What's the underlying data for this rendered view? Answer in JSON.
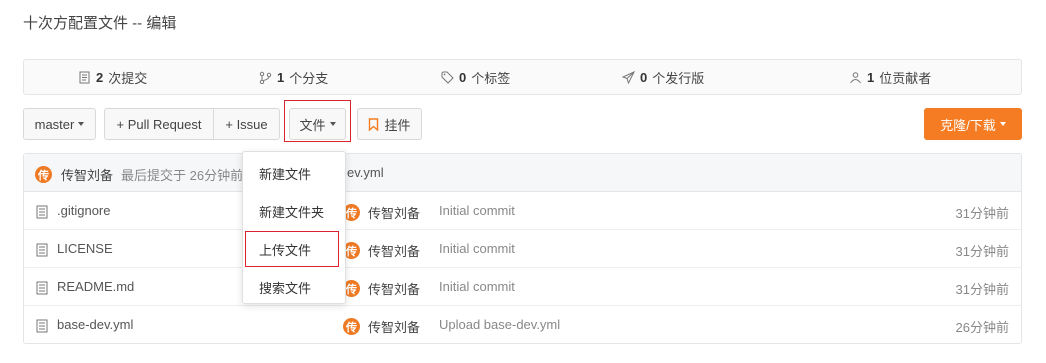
{
  "page": {
    "title": "十次方配置文件 -- 编辑"
  },
  "stats": [
    {
      "icon": "commit-icon",
      "count": "2",
      "label": "次提交"
    },
    {
      "icon": "branch-icon",
      "count": "1",
      "label": "个分支"
    },
    {
      "icon": "tag-icon",
      "count": "0",
      "label": "个标签"
    },
    {
      "icon": "release-icon",
      "count": "0",
      "label": "个发行版"
    },
    {
      "icon": "contributors-icon",
      "count": "1",
      "label": "位贡献者"
    }
  ],
  "toolbar": {
    "branch_label": "master",
    "pull_request_label": "+ Pull Request",
    "issue_label": "+ Issue",
    "file_menu_label": "文件",
    "pin_label": "挂件",
    "clone_label": "克隆/下载"
  },
  "file_menu": {
    "items": [
      "新建文件",
      "新建文件夹",
      "上传文件",
      "搜索文件"
    ]
  },
  "latest_commit": {
    "avatar_char": "传",
    "author": "传智刘备",
    "text": "最后提交于 26分钟前",
    "message_tail": "ev.yml"
  },
  "files": [
    {
      "name": ".gitignore",
      "avatar_char": "传",
      "author": "传智刘备",
      "message": "Initial commit",
      "time": "31分钟前"
    },
    {
      "name": "LICENSE",
      "avatar_char": "传",
      "author": "传智刘备",
      "message": "Initial commit",
      "time": "31分钟前"
    },
    {
      "name": "README.md",
      "avatar_char": "传",
      "author": "传智刘备",
      "message": "Initial commit",
      "time": "31分钟前"
    },
    {
      "name": "base-dev.yml",
      "avatar_char": "传",
      "author": "传智刘备",
      "message": "Upload base-dev.yml",
      "time": "26分钟前"
    }
  ],
  "colors": {
    "accent": "#f57c22",
    "highlight": "#d9232e",
    "avatar": "#ef7a24"
  }
}
